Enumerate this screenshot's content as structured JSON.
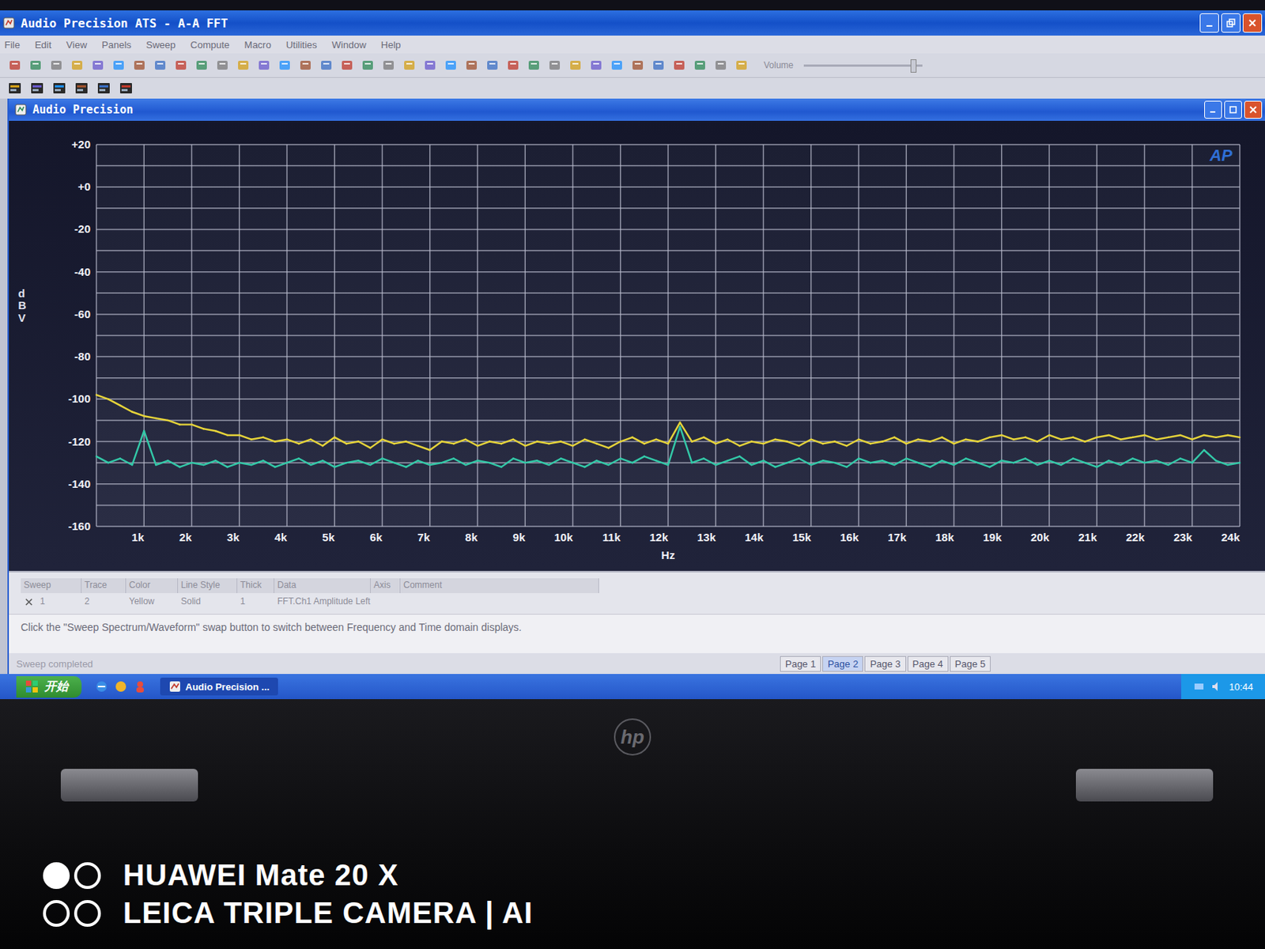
{
  "window": {
    "title": "Audio Precision ATS - A-A FFT"
  },
  "menu": [
    "File",
    "Edit",
    "View",
    "Panels",
    "Sweep",
    "Compute",
    "Macro",
    "Utilities",
    "Window",
    "Help"
  ],
  "toolbar": {
    "volume": {
      "label": "Volume",
      "level": 0.92
    }
  },
  "document_window": {
    "title": "Audio Precision"
  },
  "chart": {
    "logo": "AP",
    "y_label": "dBV",
    "x_label": "Hz",
    "y_ticks": [
      "+20",
      "+0",
      "-20",
      "-40",
      "-60",
      "-80",
      "-100",
      "-120",
      "-140",
      "-160"
    ],
    "x_ticks": [
      "1k",
      "2k",
      "3k",
      "4k",
      "5k",
      "6k",
      "7k",
      "8k",
      "9k",
      "10k",
      "11k",
      "12k",
      "13k",
      "14k",
      "15k",
      "16k",
      "17k",
      "18k",
      "19k",
      "20k",
      "21k",
      "22k",
      "23k",
      "24k"
    ],
    "series": [
      {
        "color": "#e6d43a",
        "values": [
          -98,
          -100,
          -103,
          -106,
          -108,
          -109,
          -110,
          -112,
          -112,
          -114,
          -115,
          -117,
          -117,
          -119,
          -118,
          -120,
          -119,
          -121,
          -119,
          -122,
          -118,
          -121,
          -120,
          -123,
          -119,
          -121,
          -120,
          -122,
          -124,
          -120,
          -121,
          -119,
          -122,
          -120,
          -121,
          -119,
          -122,
          -120,
          -121,
          -120,
          -122,
          -119,
          -121,
          -123,
          -120,
          -118,
          -121,
          -119,
          -121,
          -111,
          -120,
          -118,
          -121,
          -119,
          -122,
          -120,
          -121,
          -119,
          -120,
          -122,
          -119,
          -121,
          -120,
          -122,
          -119,
          -121,
          -120,
          -118,
          -121,
          -119,
          -120,
          -118,
          -121,
          -119,
          -120,
          -118,
          -117,
          -119,
          -118,
          -120,
          -117,
          -119,
          -118,
          -120,
          -118,
          -117,
          -119,
          -118,
          -117,
          -119,
          -118,
          -117,
          -119,
          -117,
          -118,
          -117,
          -118
        ]
      },
      {
        "color": "#33c9a8",
        "values": [
          -127,
          -130,
          -128,
          -131,
          -115,
          -131,
          -129,
          -132,
          -130,
          -131,
          -129,
          -132,
          -130,
          -131,
          -129,
          -132,
          -130,
          -128,
          -131,
          -129,
          -132,
          -130,
          -129,
          -131,
          -128,
          -130,
          -132,
          -129,
          -131,
          -130,
          -128,
          -131,
          -129,
          -130,
          -132,
          -128,
          -130,
          -129,
          -131,
          -128,
          -130,
          -132,
          -129,
          -131,
          -128,
          -130,
          -127,
          -129,
          -131,
          -113,
          -130,
          -128,
          -131,
          -129,
          -127,
          -131,
          -129,
          -132,
          -130,
          -128,
          -131,
          -129,
          -130,
          -132,
          -128,
          -130,
          -129,
          -131,
          -128,
          -130,
          -132,
          -129,
          -131,
          -128,
          -130,
          -132,
          -129,
          -130,
          -128,
          -131,
          -129,
          -131,
          -128,
          -130,
          -132,
          -129,
          -131,
          -128,
          -130,
          -129,
          -131,
          -128,
          -130,
          -124,
          -129,
          -131,
          -130
        ]
      }
    ]
  },
  "legend_table": {
    "columns": [
      "Sweep",
      "Trace",
      "Color",
      "Line Style",
      "Thick",
      "Data",
      "Axis",
      "Comment"
    ],
    "rows": [
      {
        "checked": true,
        "cells": [
          "1",
          "2",
          "Yellow",
          "Solid",
          "1",
          "FFT.Ch1 Amplitude Left",
          "",
          ""
        ]
      }
    ]
  },
  "help_text": "Click the \"Sweep Spectrum/Waveform\" swap button to switch between Frequency and Time domain displays.",
  "status_bar": {
    "text": "Sweep completed",
    "pages": [
      {
        "label": "Page 1",
        "selected": false
      },
      {
        "label": "Page 2",
        "selected": true
      },
      {
        "label": "Page 3",
        "selected": false
      },
      {
        "label": "Page 4",
        "selected": false
      },
      {
        "label": "Page 5",
        "selected": false
      }
    ]
  },
  "taskbar": {
    "start": "开始",
    "tasks": [
      {
        "label": "Audio Precision ...",
        "selected": true
      }
    ],
    "clock": "10:44"
  },
  "laptop": {
    "logo": "hp"
  },
  "watermark": {
    "lines": [
      "HUAWEI Mate 20 X",
      "LEICA TRIPLE CAMERA | AI"
    ]
  }
}
